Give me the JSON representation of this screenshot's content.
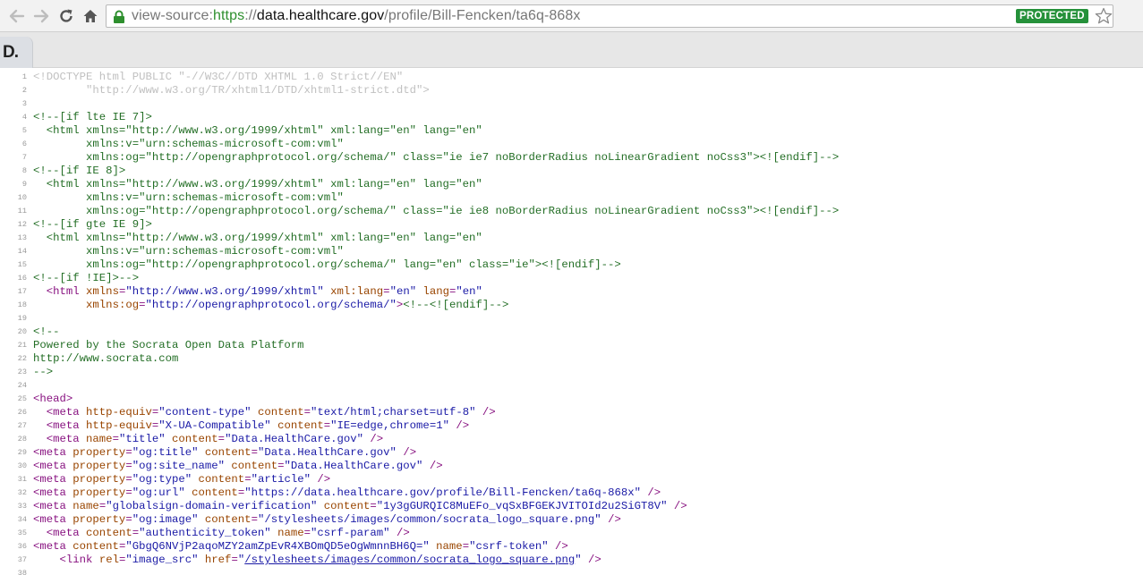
{
  "browser": {
    "url": {
      "view_source": "view-source:",
      "scheme": "https",
      "sep": "://",
      "host": "data.healthcare.gov",
      "path": "/profile/Bill-Fencken/ta6q-868x"
    },
    "badge": "PROTECTED",
    "tab_logo": "D.",
    "icons": [
      "back-arrow-icon",
      "forward-arrow-icon",
      "reload-icon",
      "home-icon",
      "lock-icon",
      "star-icon"
    ]
  },
  "lines": [
    {
      "n": "1",
      "segs": [
        [
          "doctype",
          "<!DOCTYPE html PUBLIC \"-//W3C//DTD XHTML 1.0 Strict//EN\""
        ]
      ]
    },
    {
      "n": "2",
      "segs": [
        [
          "doctype",
          "        \"http://www.w3.org/TR/xhtml1/DTD/xhtml1-strict.dtd\">"
        ]
      ]
    },
    {
      "n": "3",
      "segs": []
    },
    {
      "n": "4",
      "segs": [
        [
          "comment",
          "<!--[if lte IE 7]>"
        ]
      ]
    },
    {
      "n": "5",
      "segs": [
        [
          "comment",
          "  <html xmlns=\"http://www.w3.org/1999/xhtml\" xml:lang=\"en\" lang=\"en\""
        ]
      ]
    },
    {
      "n": "6",
      "segs": [
        [
          "comment",
          "        xmlns:v=\"urn:schemas-microsoft-com:vml\""
        ]
      ]
    },
    {
      "n": "7",
      "segs": [
        [
          "comment",
          "        xmlns:og=\"http://opengraphprotocol.org/schema/\" class=\"ie ie7 noBorderRadius noLinearGradient noCss3\"><![endif]-->"
        ]
      ]
    },
    {
      "n": "8",
      "segs": [
        [
          "comment",
          "<!--[if IE 8]>"
        ]
      ]
    },
    {
      "n": "9",
      "segs": [
        [
          "comment",
          "  <html xmlns=\"http://www.w3.org/1999/xhtml\" xml:lang=\"en\" lang=\"en\""
        ]
      ]
    },
    {
      "n": "10",
      "segs": [
        [
          "comment",
          "        xmlns:v=\"urn:schemas-microsoft-com:vml\""
        ]
      ]
    },
    {
      "n": "11",
      "segs": [
        [
          "comment",
          "        xmlns:og=\"http://opengraphprotocol.org/schema/\" class=\"ie ie8 noBorderRadius noLinearGradient noCss3\"><![endif]-->"
        ]
      ]
    },
    {
      "n": "12",
      "segs": [
        [
          "comment",
          "<!--[if gte IE 9]>"
        ]
      ]
    },
    {
      "n": "13",
      "segs": [
        [
          "comment",
          "  <html xmlns=\"http://www.w3.org/1999/xhtml\" xml:lang=\"en\" lang=\"en\""
        ]
      ]
    },
    {
      "n": "14",
      "segs": [
        [
          "comment",
          "        xmlns:v=\"urn:schemas-microsoft-com:vml\""
        ]
      ]
    },
    {
      "n": "15",
      "segs": [
        [
          "comment",
          "        xmlns:og=\"http://opengraphprotocol.org/schema/\" lang=\"en\" class=\"ie\"><![endif]-->"
        ]
      ]
    },
    {
      "n": "16",
      "segs": [
        [
          "comment",
          "<!--[if !IE]>-->"
        ]
      ]
    },
    {
      "n": "17",
      "segs": [
        [
          "plain",
          "  "
        ],
        [
          "tag",
          "<html "
        ],
        [
          "attr",
          "xmlns"
        ],
        [
          "tag",
          "="
        ],
        [
          "val",
          "\"http://www.w3.org/1999/xhtml\""
        ],
        [
          "plain",
          " "
        ],
        [
          "attr",
          "xml:lang"
        ],
        [
          "tag",
          "="
        ],
        [
          "val",
          "\"en\""
        ],
        [
          "plain",
          " "
        ],
        [
          "attr",
          "lang"
        ],
        [
          "tag",
          "="
        ],
        [
          "val",
          "\"en\""
        ]
      ]
    },
    {
      "n": "18",
      "segs": [
        [
          "plain",
          "        "
        ],
        [
          "attr",
          "xmlns:og"
        ],
        [
          "tag",
          "="
        ],
        [
          "val",
          "\"http://opengraphprotocol.org/schema/\""
        ],
        [
          "tag",
          ">"
        ],
        [
          "comment",
          "<!--<![endif]-->"
        ]
      ]
    },
    {
      "n": "19",
      "segs": []
    },
    {
      "n": "20",
      "segs": [
        [
          "comment",
          "<!--"
        ]
      ]
    },
    {
      "n": "21",
      "segs": [
        [
          "comment",
          "Powered by the Socrata Open Data Platform"
        ]
      ]
    },
    {
      "n": "22",
      "segs": [
        [
          "comment",
          "http://www.socrata.com"
        ]
      ]
    },
    {
      "n": "23",
      "segs": [
        [
          "comment",
          "-->"
        ]
      ]
    },
    {
      "n": "24",
      "segs": []
    },
    {
      "n": "25",
      "segs": [
        [
          "tag",
          "<head>"
        ]
      ]
    },
    {
      "n": "26",
      "segs": [
        [
          "plain",
          "  "
        ],
        [
          "tag",
          "<meta "
        ],
        [
          "attr",
          "http-equiv"
        ],
        [
          "tag",
          "="
        ],
        [
          "val",
          "\"content-type\""
        ],
        [
          "plain",
          " "
        ],
        [
          "attr",
          "content"
        ],
        [
          "tag",
          "="
        ],
        [
          "val",
          "\"text/html;charset=utf-8\""
        ],
        [
          "plain",
          " "
        ],
        [
          "tag",
          "/>"
        ]
      ]
    },
    {
      "n": "27",
      "segs": [
        [
          "plain",
          "  "
        ],
        [
          "tag",
          "<meta "
        ],
        [
          "attr",
          "http-equiv"
        ],
        [
          "tag",
          "="
        ],
        [
          "val",
          "\"X-UA-Compatible\""
        ],
        [
          "plain",
          " "
        ],
        [
          "attr",
          "content"
        ],
        [
          "tag",
          "="
        ],
        [
          "val",
          "\"IE=edge,chrome=1\""
        ],
        [
          "plain",
          " "
        ],
        [
          "tag",
          "/>"
        ]
      ]
    },
    {
      "n": "28",
      "segs": [
        [
          "plain",
          "  "
        ],
        [
          "tag",
          "<meta "
        ],
        [
          "attr",
          "name"
        ],
        [
          "tag",
          "="
        ],
        [
          "val",
          "\"title\""
        ],
        [
          "plain",
          " "
        ],
        [
          "attr",
          "content"
        ],
        [
          "tag",
          "="
        ],
        [
          "val",
          "\"Data.HealthCare.gov\""
        ],
        [
          "plain",
          " "
        ],
        [
          "tag",
          "/>"
        ]
      ]
    },
    {
      "n": "29",
      "segs": [
        [
          "tag",
          "<meta "
        ],
        [
          "attr",
          "property"
        ],
        [
          "tag",
          "="
        ],
        [
          "val",
          "\"og:title\""
        ],
        [
          "plain",
          " "
        ],
        [
          "attr",
          "content"
        ],
        [
          "tag",
          "="
        ],
        [
          "val",
          "\"Data.HealthCare.gov\""
        ],
        [
          "plain",
          " "
        ],
        [
          "tag",
          "/>"
        ]
      ]
    },
    {
      "n": "30",
      "segs": [
        [
          "tag",
          "<meta "
        ],
        [
          "attr",
          "property"
        ],
        [
          "tag",
          "="
        ],
        [
          "val",
          "\"og:site_name\""
        ],
        [
          "plain",
          " "
        ],
        [
          "attr",
          "content"
        ],
        [
          "tag",
          "="
        ],
        [
          "val",
          "\"Data.HealthCare.gov\""
        ],
        [
          "plain",
          " "
        ],
        [
          "tag",
          "/>"
        ]
      ]
    },
    {
      "n": "31",
      "segs": [
        [
          "tag",
          "<meta "
        ],
        [
          "attr",
          "property"
        ],
        [
          "tag",
          "="
        ],
        [
          "val",
          "\"og:type\""
        ],
        [
          "plain",
          " "
        ],
        [
          "attr",
          "content"
        ],
        [
          "tag",
          "="
        ],
        [
          "val",
          "\"article\""
        ],
        [
          "plain",
          " "
        ],
        [
          "tag",
          "/>"
        ]
      ]
    },
    {
      "n": "32",
      "segs": [
        [
          "tag",
          "<meta "
        ],
        [
          "attr",
          "property"
        ],
        [
          "tag",
          "="
        ],
        [
          "val",
          "\"og:url\""
        ],
        [
          "plain",
          " "
        ],
        [
          "attr",
          "content"
        ],
        [
          "tag",
          "="
        ],
        [
          "val",
          "\"https://data.healthcare.gov/profile/Bill-Fencken/ta6q-868x\""
        ],
        [
          "plain",
          " "
        ],
        [
          "tag",
          "/>"
        ]
      ]
    },
    {
      "n": "33",
      "segs": [
        [
          "tag",
          "<meta "
        ],
        [
          "attr",
          "name"
        ],
        [
          "tag",
          "="
        ],
        [
          "val",
          "\"globalsign-domain-verification\""
        ],
        [
          "plain",
          " "
        ],
        [
          "attr",
          "content"
        ],
        [
          "tag",
          "="
        ],
        [
          "val",
          "\"1y3gGURQIC8MuEFo_vqSxBFGEKJVITOId2u2SiGT8V\""
        ],
        [
          "plain",
          " "
        ],
        [
          "tag",
          "/>"
        ]
      ]
    },
    {
      "n": "34",
      "segs": [
        [
          "tag",
          "<meta "
        ],
        [
          "attr",
          "property"
        ],
        [
          "tag",
          "="
        ],
        [
          "val",
          "\"og:image\""
        ],
        [
          "plain",
          " "
        ],
        [
          "attr",
          "content"
        ],
        [
          "tag",
          "="
        ],
        [
          "val",
          "\"/stylesheets/images/common/socrata_logo_square.png\""
        ],
        [
          "plain",
          " "
        ],
        [
          "tag",
          "/>"
        ]
      ]
    },
    {
      "n": "35",
      "segs": [
        [
          "plain",
          "  "
        ],
        [
          "tag",
          "<meta "
        ],
        [
          "attr",
          "content"
        ],
        [
          "tag",
          "="
        ],
        [
          "val",
          "\"authenticity_token\""
        ],
        [
          "plain",
          " "
        ],
        [
          "attr",
          "name"
        ],
        [
          "tag",
          "="
        ],
        [
          "val",
          "\"csrf-param\""
        ],
        [
          "plain",
          " "
        ],
        [
          "tag",
          "/>"
        ]
      ]
    },
    {
      "n": "36",
      "segs": [
        [
          "tag",
          "<meta "
        ],
        [
          "attr",
          "content"
        ],
        [
          "tag",
          "="
        ],
        [
          "val",
          "\"GbgQ6NVjP2aqoMZY2amZpEvR4XBOmQD5eOgWmnnBH6Q=\""
        ],
        [
          "plain",
          " "
        ],
        [
          "attr",
          "name"
        ],
        [
          "tag",
          "="
        ],
        [
          "val",
          "\"csrf-token\""
        ],
        [
          "plain",
          " "
        ],
        [
          "tag",
          "/>"
        ]
      ]
    },
    {
      "n": "37",
      "segs": [
        [
          "plain",
          "    "
        ],
        [
          "tag",
          "<link "
        ],
        [
          "attr",
          "rel"
        ],
        [
          "tag",
          "="
        ],
        [
          "val",
          "\"image_src\""
        ],
        [
          "plain",
          " "
        ],
        [
          "attr",
          "href"
        ],
        [
          "tag",
          "="
        ],
        [
          "val",
          "\""
        ],
        [
          "link",
          "/stylesheets/images/common/socrata_logo_square.png"
        ],
        [
          "val",
          "\""
        ],
        [
          "plain",
          " "
        ],
        [
          "tag",
          "/>"
        ]
      ]
    },
    {
      "n": "38",
      "segs": []
    }
  ]
}
